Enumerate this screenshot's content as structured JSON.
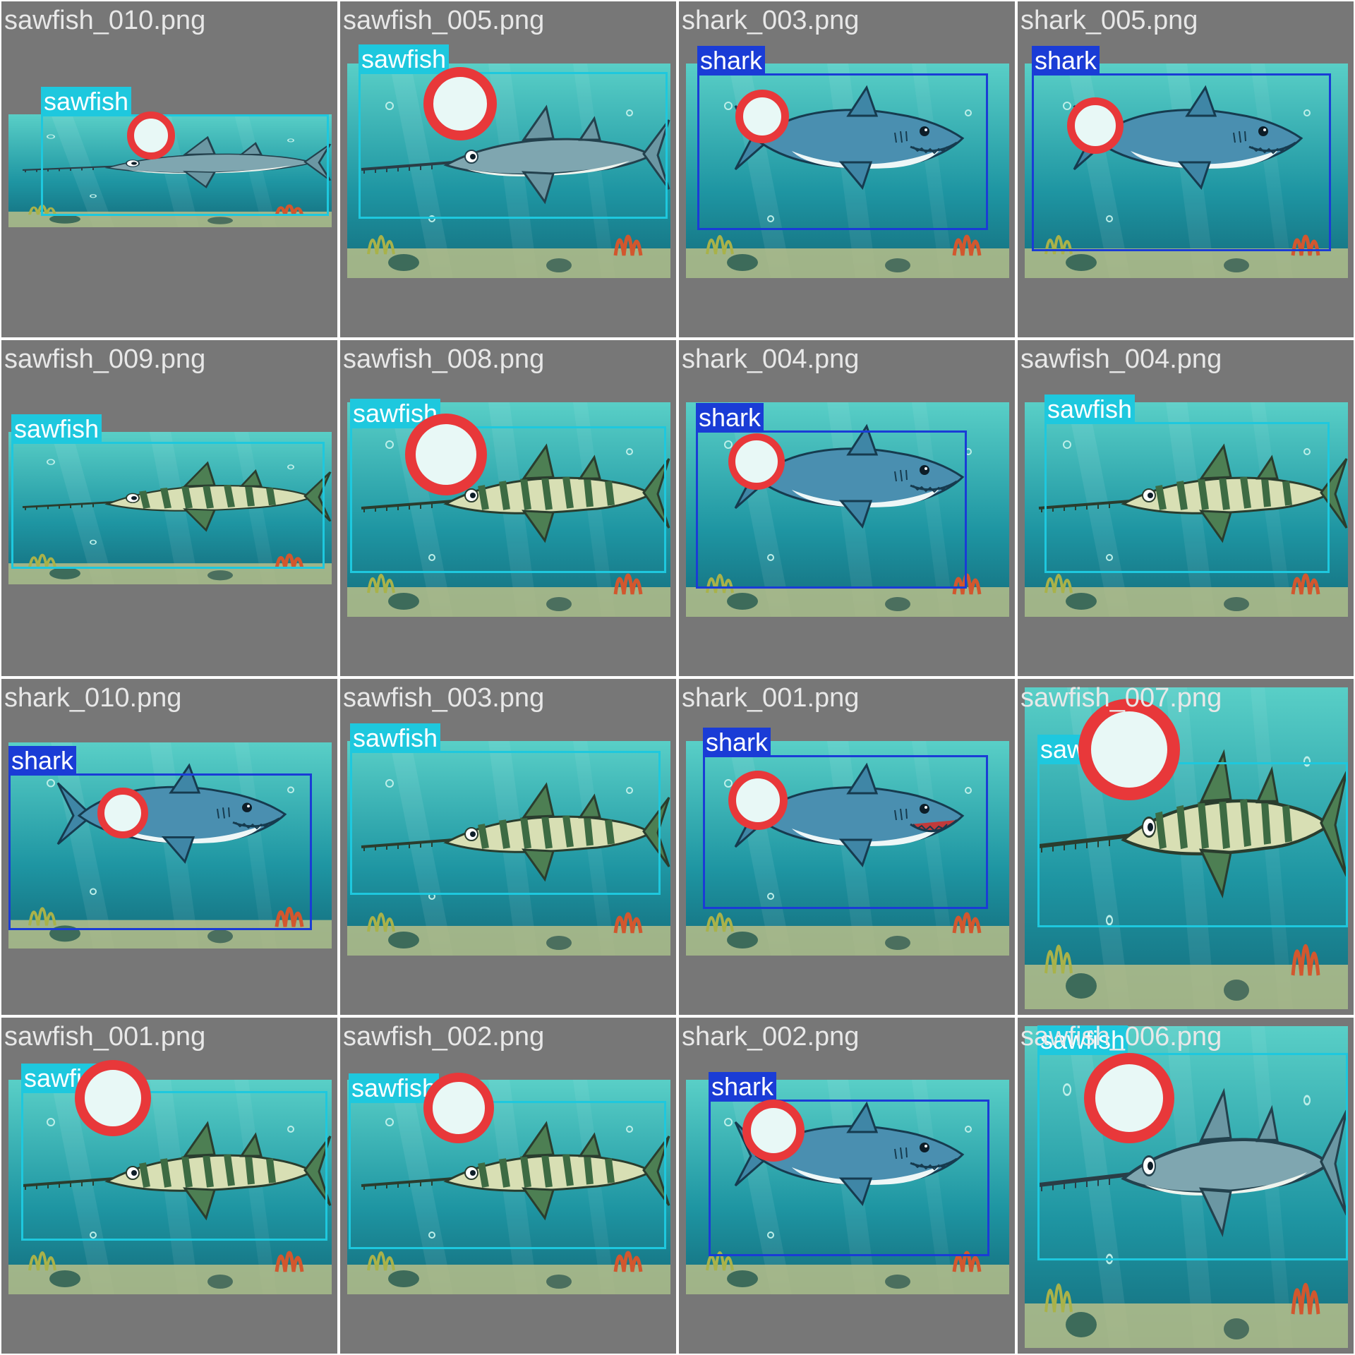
{
  "colors": {
    "sawfish": "#1ec8de",
    "shark": "#1a3cd6",
    "marker_ring": "#e8383a",
    "marker_fill": "#e8f8f6",
    "tile_bg": "#777777",
    "water_light": "#48c3c0",
    "water_dark": "#0f6f80",
    "sand": "#c3c48a"
  },
  "tiles": [
    {
      "filename": "sawfish_010.png",
      "label": "sawfish",
      "fish": "sawfish-grey-icon"
    },
    {
      "filename": "sawfish_005.png",
      "label": "sawfish",
      "fish": "sawfish-grey-icon"
    },
    {
      "filename": "shark_003.png",
      "label": "shark",
      "fish": "shark-icon"
    },
    {
      "filename": "shark_005.png",
      "label": "shark",
      "fish": "shark-icon"
    },
    {
      "filename": "sawfish_009.png",
      "label": "sawfish",
      "fish": "sawfish-striped-icon"
    },
    {
      "filename": "sawfish_008.png",
      "label": "sawfish",
      "fish": "sawfish-striped-icon"
    },
    {
      "filename": "shark_004.png",
      "label": "shark",
      "fish": "shark-icon"
    },
    {
      "filename": "sawfish_004.png",
      "label": "sawfish",
      "fish": "sawfish-striped-icon"
    },
    {
      "filename": "shark_010.png",
      "label": "shark",
      "fish": "shark-icon"
    },
    {
      "filename": "sawfish_003.png",
      "label": "sawfish",
      "fish": "sawfish-striped-icon"
    },
    {
      "filename": "shark_001.png",
      "label": "shark",
      "fish": "shark-angry-icon"
    },
    {
      "filename": "sawfish_007.png",
      "label": "sawfish",
      "fish": "sawfish-striped-icon"
    },
    {
      "filename": "sawfish_001.png",
      "label": "sawfish",
      "fish": "sawfish-striped-icon"
    },
    {
      "filename": "sawfish_002.png",
      "label": "sawfish",
      "fish": "sawfish-striped-icon"
    },
    {
      "filename": "shark_002.png",
      "label": "shark",
      "fish": "shark-icon"
    },
    {
      "filename": "sawfish_006.png",
      "label": "sawfish",
      "fish": "sawfish-grey-icon"
    }
  ]
}
